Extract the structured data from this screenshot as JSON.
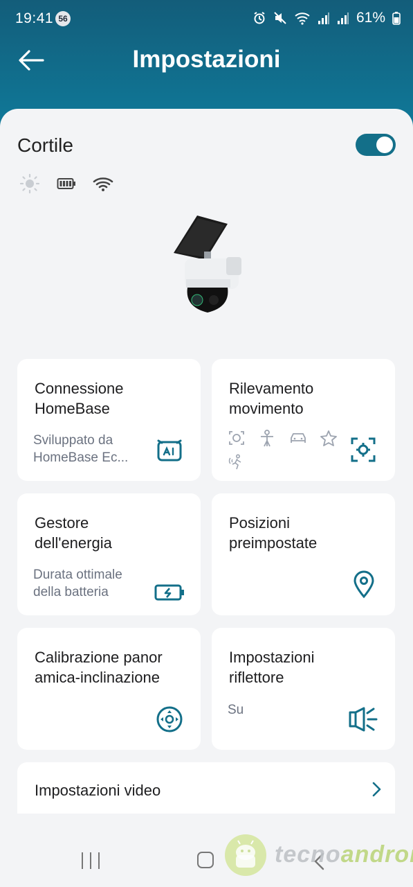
{
  "status_bar": {
    "time": "19:41",
    "notification_count": "56",
    "battery_percent": "61%"
  },
  "header": {
    "title": "Impostazioni"
  },
  "device": {
    "name": "Cortile",
    "enabled": true,
    "status_icons": [
      "sun-icon",
      "battery-icon",
      "wifi-icon"
    ]
  },
  "cards": {
    "connection": {
      "title_line1": "Connessione",
      "title_line2": "HomeBase",
      "desc_line1": "Sviluppato da",
      "desc_line2": "HomeBase Ec..."
    },
    "motion": {
      "title_line1": "Rilevamento",
      "title_line2": "movimento",
      "detect_icons": [
        "face-icon",
        "person-icon",
        "vehicle-icon",
        "pet-icon",
        "motion-icon"
      ]
    },
    "energy": {
      "title_line1": "Gestore",
      "title_line2": "dell'energia",
      "desc_line1": "Durata ottimale",
      "desc_line2": "della batteria"
    },
    "presets": {
      "title_line1": "Posizioni",
      "title_line2": "preimpostate"
    },
    "calibration": {
      "title_line1": "Calibrazione panor",
      "title_line2": "amica-inclinazione"
    },
    "floodlight": {
      "title_line1": "Impostazioni",
      "title_line2": "riflettore",
      "value": "Su"
    }
  },
  "video_settings": {
    "label": "Impostazioni video"
  },
  "watermark": {
    "part1": "tecno",
    "part2": "android"
  },
  "colors": {
    "accent": "#136f89",
    "header": "#135d7a"
  }
}
